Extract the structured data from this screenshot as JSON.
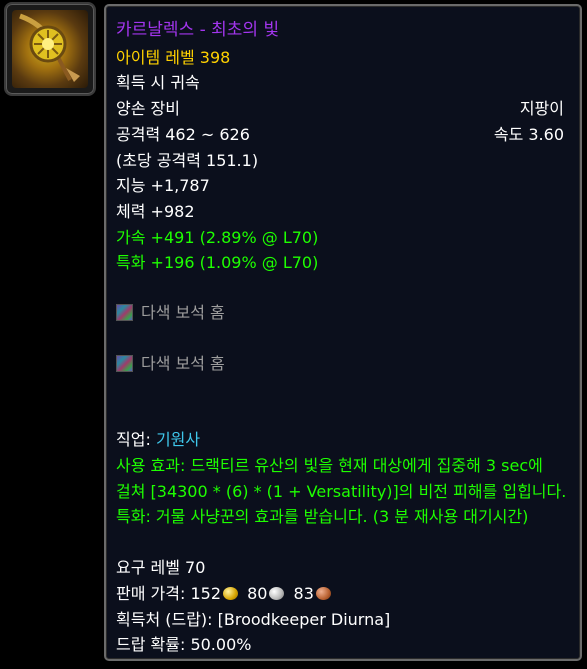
{
  "item": {
    "icon_name": "gem-pendant-icon",
    "name": "카르날렉스 - 최초의 빛",
    "item_level_label": "아이템 레벨",
    "item_level_value": "398",
    "bind": "획득 시 귀속",
    "slot": "양손 장비",
    "type": "지팡이",
    "damage": "공격력 462 ~ 626",
    "speed": "속도 3.60",
    "dps": "(초당 공격력 151.1)",
    "stats": [
      {
        "label": "지능",
        "value": "+1,787"
      },
      {
        "label": "체력",
        "value": "+982"
      }
    ],
    "secondary": [
      {
        "label": "가속",
        "value": "+491",
        "extra": "(2.89% @ L70)"
      },
      {
        "label": "특화",
        "value": "+196",
        "extra": "(1.09% @ L70)"
      }
    ],
    "sockets": [
      "다색 보석 홈",
      "다색 보석 홈"
    ],
    "class_label": "직업:",
    "class_value": "기원사",
    "use_effect": "사용 효과: 드랙티르 유산의 빛을 현재 대상에게 집중해 3 sec에 걸쳐 [34300 * (6) * (1 + Versatility)]의 비전 피해를 입힙니다. 특화: 거물 사냥꾼의 효과를 받습니다. (3 분 재사용 대기시간)",
    "required_level": "요구 레벨 70",
    "sell_price_label": "판매 가격:",
    "sell_gold": "152",
    "sell_silver": "80",
    "sell_copper": "83",
    "source": "획득처 (드랍): [Broodkeeper Diurna]",
    "drop_chance": "드랍 확률: 50.00%"
  },
  "colors": {
    "epic": "#a335ee",
    "item_level": "#ffd100",
    "green": "#1eff00",
    "socket_gray": "#9d9d9d",
    "class_evoker": "#3fc7eb",
    "background": "#0b0f1c"
  }
}
